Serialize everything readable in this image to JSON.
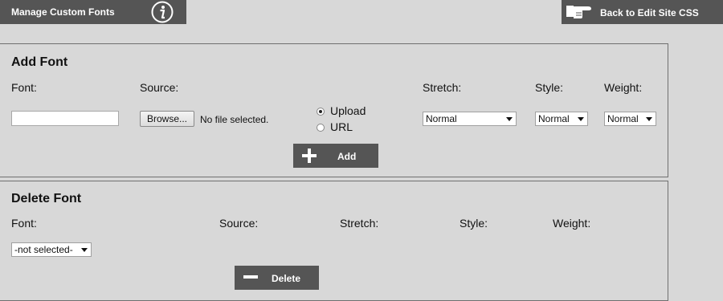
{
  "header": {
    "title": "Manage Custom Fonts",
    "back_label": "Back to Edit Site CSS"
  },
  "add_font": {
    "title": "Add Font",
    "labels": {
      "font": "Font:",
      "source": "Source:",
      "stretch": "Stretch:",
      "style": "Style:",
      "weight": "Weight:"
    },
    "font_value": "",
    "browse_label": "Browse...",
    "file_status": "No file selected.",
    "source_options": [
      {
        "label": "Upload",
        "checked": true
      },
      {
        "label": "URL",
        "checked": false
      }
    ],
    "stretch_value": "Normal",
    "style_value": "Normal",
    "weight_value": "Normal",
    "add_label": "Add"
  },
  "delete_font": {
    "title": "Delete Font",
    "labels": {
      "font": "Font:",
      "source": "Source:",
      "stretch": "Stretch:",
      "style": "Style:",
      "weight": "Weight:"
    },
    "font_select_value": "-not selected-",
    "delete_label": "Delete"
  },
  "colors": {
    "bar": "#555555",
    "background": "#d8d8d8"
  }
}
